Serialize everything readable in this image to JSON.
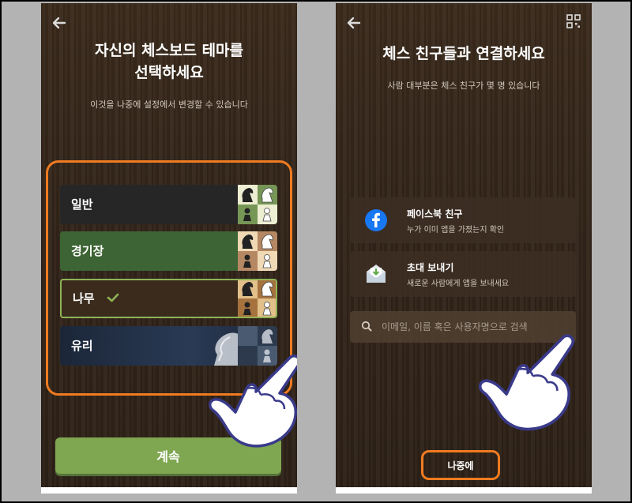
{
  "left_screen": {
    "title_line1": "자신의 체스보드 테마를",
    "title_line2": "선택하세요",
    "subtitle": "이것을 나중에 설정에서 변경할 수 있습니다",
    "themes": [
      {
        "label": "일반",
        "bg": "#2b2b2b",
        "selected": false
      },
      {
        "label": "경기장",
        "bg": "#3f6a35",
        "selected": false
      },
      {
        "label": "나무",
        "bg": "#3a2a1c",
        "selected": true
      },
      {
        "label": "유리",
        "bg": "#1f2c42",
        "selected": false
      }
    ],
    "continue_label": "계속",
    "accent_color": "#7fa650",
    "highlight_color": "#f07b20"
  },
  "right_screen": {
    "title": "체스 친구들과 연결하세요",
    "subtitle": "사람 대부분은 체스 친구가 몇 명 있습니다",
    "options": [
      {
        "title": "페이스북 친구",
        "subtitle": "누가 이미 앱을 가졌는지 확인",
        "icon": "facebook-icon"
      },
      {
        "title": "초대 보내기",
        "subtitle": "새로운 사람에게 앱을 보내세요",
        "icon": "envelope-icon"
      }
    ],
    "search_placeholder": "이메일, 이름 혹은 사용자명으로 검색",
    "later_label": "나중에"
  }
}
